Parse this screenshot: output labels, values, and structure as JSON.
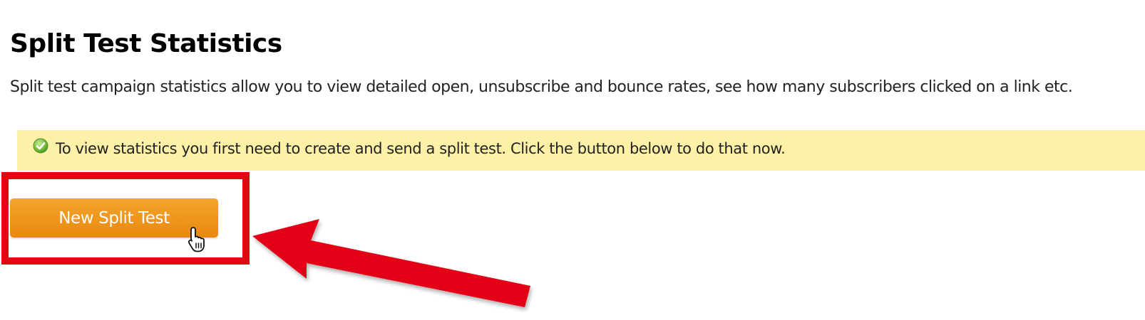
{
  "page": {
    "title": "Split Test Statistics",
    "description": "Split test campaign statistics allow you to view detailed open, unsubscribe and bounce rates, see how many subscribers clicked on a link etc."
  },
  "notice": {
    "icon": "check-circle-icon",
    "text": "To view statistics you first need to create and send a split test. Click the button below to do that now.",
    "background_color": "#fdf0a7"
  },
  "actions": {
    "new_split_test_label": "New Split Test",
    "button_color": "#ee9419"
  },
  "annotation": {
    "highlight_color": "#e30613",
    "arrow_icon": "red-arrow-icon",
    "cursor_icon": "hand-pointer-icon"
  }
}
